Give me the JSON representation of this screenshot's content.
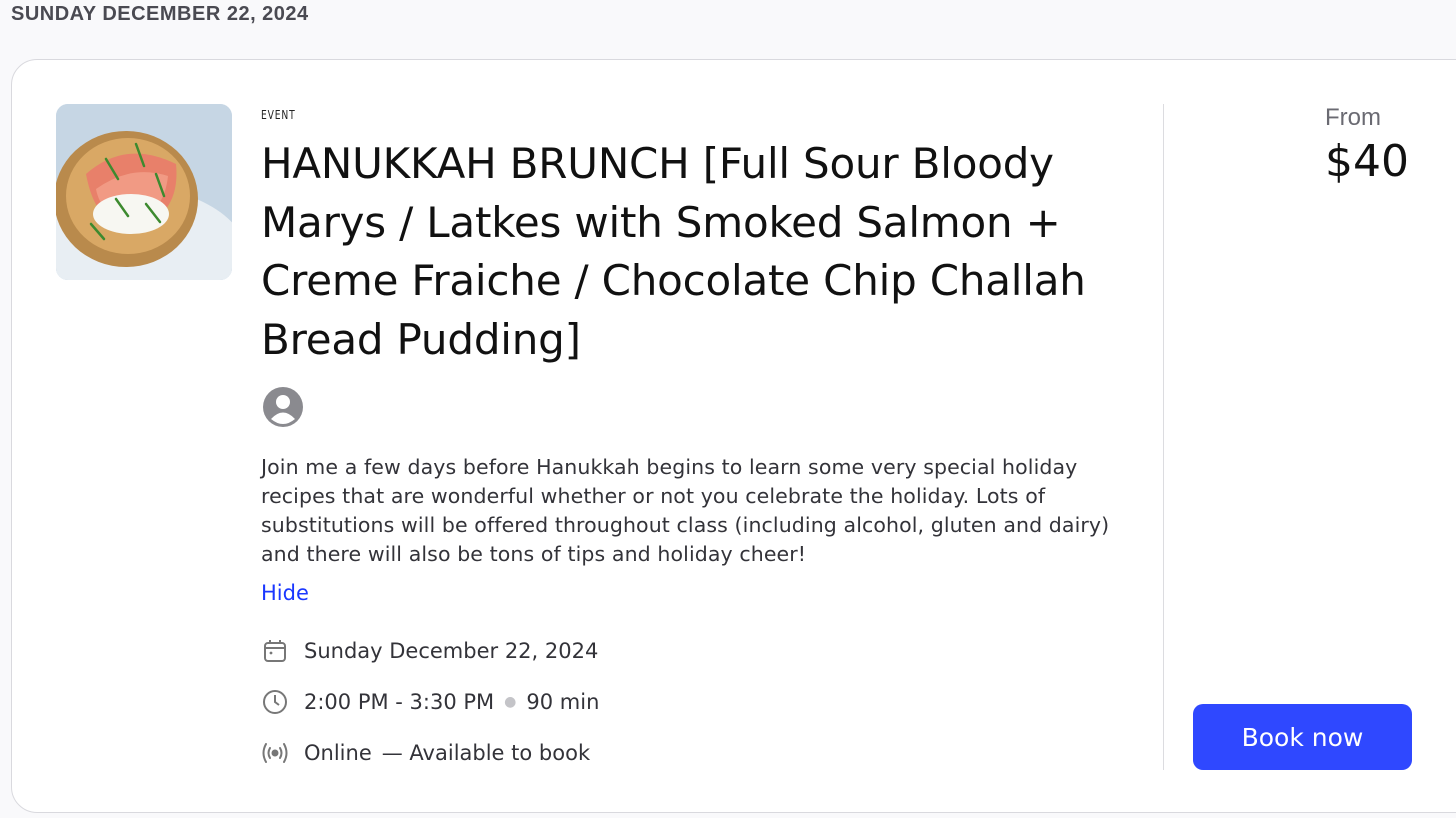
{
  "page": {
    "date_heading": "SUNDAY DECEMBER 22, 2024"
  },
  "event": {
    "tag": "EVENT",
    "title": "HANUKKAH BRUNCH [Full Sour Bloody Marys / Latkes with Smoked Salmon + Creme Fraiche / Chocolate Chip Challah Bread Pudding]",
    "description": "Join me a few days before Hanukkah begins to learn some very special holiday recipes that are wonderful whether or not you celebrate the holiday. Lots of substitutions will be offered throughout class (including alcohol, gluten and dairy) and there will also be tons of tips and holiday cheer!",
    "hide_label": "Hide",
    "date": "Sunday December 22, 2024",
    "time": "2:00 PM - 3:30 PM",
    "duration": "90 min",
    "location": "Online",
    "availability": "— Available to book"
  },
  "pricing": {
    "from_label": "From",
    "price": "$40",
    "book_label": "Book now"
  },
  "icons": {
    "avatar": "user-avatar-icon",
    "date": "calendar-icon",
    "time": "clock-icon",
    "location": "broadcast-icon"
  },
  "colors": {
    "accent": "#2f48ff",
    "link": "#1a37ff"
  }
}
